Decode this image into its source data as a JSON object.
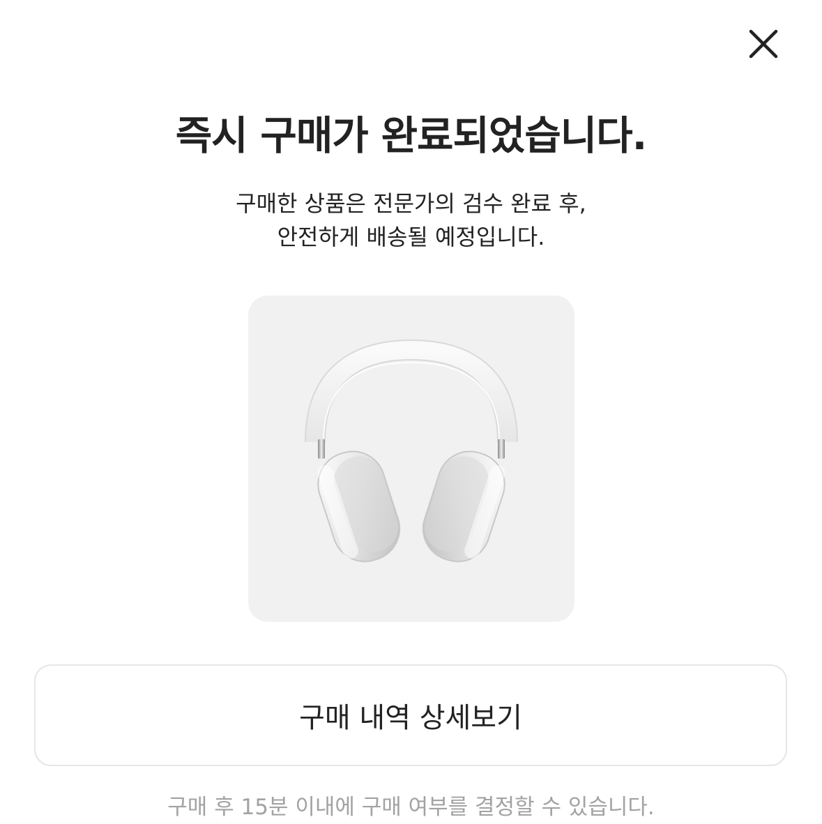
{
  "close": {
    "icon": "close-icon",
    "label": ""
  },
  "header": {
    "title": "즉시 구매가 완료되었습니다.",
    "subtitle_line1": "구매한 상품은 전문가의 검수 완료 후,",
    "subtitle_line2": "안전하게 배송될 예정입니다."
  },
  "product": {
    "image": "over-ear-headphones-silver"
  },
  "actions": {
    "detail_button_label": "구매 내역 상세보기"
  },
  "footer": {
    "notice": "구매 후 15분 이내에 구매 여부를 결정할 수 있습니다."
  },
  "colors": {
    "text_primary": "#222222",
    "text_muted": "#a2a2a2",
    "card_background": "#f1f1f1",
    "button_border": "#e6e6e6"
  }
}
